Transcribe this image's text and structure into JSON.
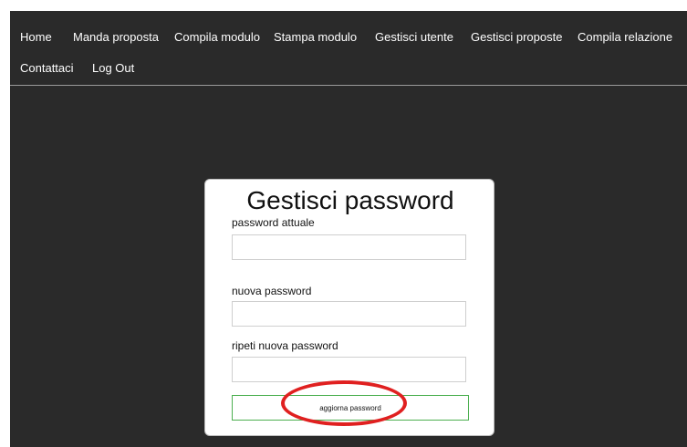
{
  "nav": {
    "links": [
      {
        "label": "Home"
      },
      {
        "label": "Manda proposta"
      },
      {
        "label": "Compila modulo"
      },
      {
        "label": "Stampa modulo"
      },
      {
        "label": "Gestisci utente"
      },
      {
        "label": "Gestisci proposte"
      },
      {
        "label": "Compila relazione"
      },
      {
        "label": "Contattaci"
      },
      {
        "label": "Log Out"
      }
    ]
  },
  "form": {
    "title": "Gestisci password",
    "fields": [
      {
        "label": "password attuale",
        "value": "",
        "placeholder": ""
      },
      {
        "label": "nuova password",
        "value": "",
        "placeholder": ""
      },
      {
        "label": "ripeti nuova password",
        "value": "",
        "placeholder": ""
      }
    ],
    "submit_label": "aggiorna password"
  },
  "colors": {
    "page_background": "#2a2a2a",
    "nav_text": "#ffffff",
    "card_background": "#ffffff",
    "button_border": "#4caf50",
    "annotation": "#e02020"
  },
  "annotation": {
    "shape": "ellipse",
    "highlights": "submit-button"
  }
}
